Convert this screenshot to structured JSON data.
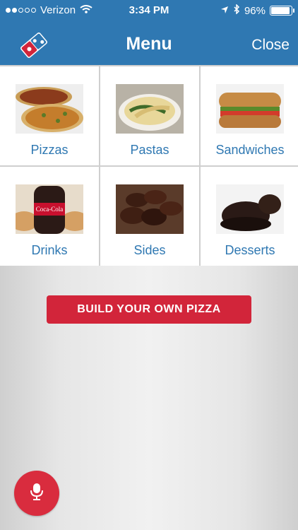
{
  "status_bar": {
    "carrier": "Verizon",
    "time": "3:34 PM",
    "battery": "96%",
    "signal_icon": "signal-dots-icon",
    "wifi_icon": "wifi-icon",
    "location_icon": "location-arrow-icon",
    "bluetooth_icon": "bluetooth-icon",
    "battery_icon": "battery-icon"
  },
  "nav": {
    "title": "Menu",
    "close_label": "Close",
    "logo_icon": "dominos-logo-icon"
  },
  "categories": [
    {
      "label": "Pizzas",
      "icon": "pizza-image"
    },
    {
      "label": "Pastas",
      "icon": "pasta-image"
    },
    {
      "label": "Sandwiches",
      "icon": "sandwich-image"
    },
    {
      "label": "Drinks",
      "icon": "drink-image"
    },
    {
      "label": "Sides",
      "icon": "wings-image"
    },
    {
      "label": "Desserts",
      "icon": "dessert-image"
    }
  ],
  "actions": {
    "build_label": "BUILD YOUR OWN PIZZA"
  },
  "voice": {
    "icon": "microphone-icon"
  },
  "colors": {
    "brand_blue": "#2f78b2",
    "brand_red": "#d2253a"
  }
}
